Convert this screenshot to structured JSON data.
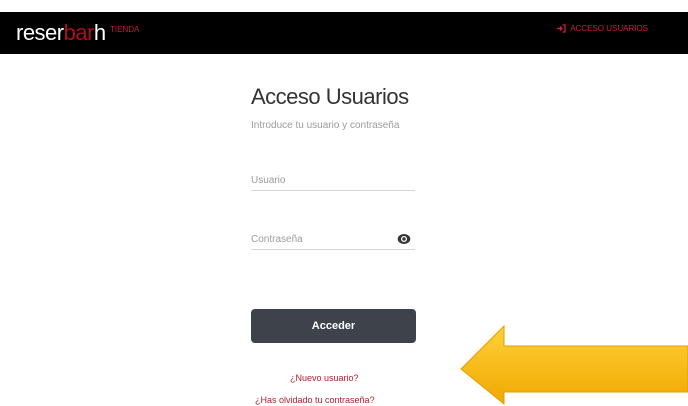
{
  "header": {
    "logo_part1": "reser",
    "logo_part2": "bar",
    "logo_part3": "h",
    "nav_tienda": "TIENDA",
    "nav_access": "ACCESO USUARIOS"
  },
  "login": {
    "title": "Acceso Usuarios",
    "subtitle": "Introduce tu usuario y contraseña",
    "username_placeholder": "Usuario",
    "password_placeholder": "Contraseña",
    "submit_label": "Acceder",
    "new_user_link": "¿Nuevo usuario?",
    "forgot_password_link": "¿Has olvidado tu contraseña?"
  },
  "icons": {
    "login": "login-arrow-icon",
    "password_toggle": "eye-icon",
    "pointer": "yellow-arrow-pointer"
  },
  "colors": {
    "header_bg": "#000000",
    "brand_red": "#b00d1d",
    "button_bg": "#3e434b",
    "link_red": "#b01e2e",
    "pointer_yellow": "#f5b800"
  }
}
